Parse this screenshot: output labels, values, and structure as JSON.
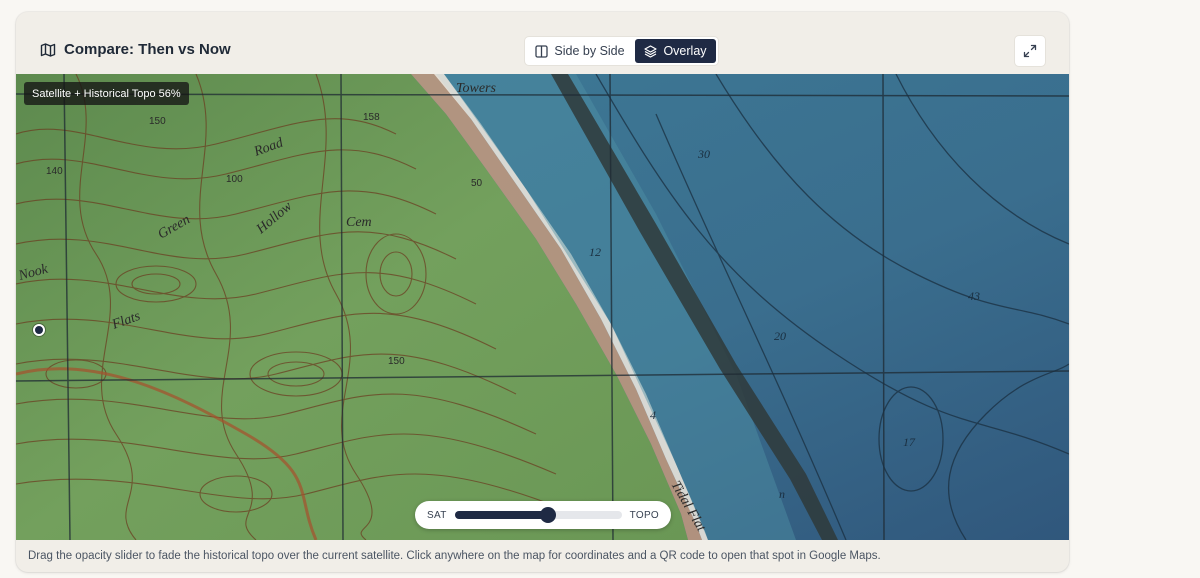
{
  "header": {
    "title": "Compare: Then vs Now",
    "title_icon": "map-icon",
    "view_modes": [
      {
        "label": "Side by Side",
        "icon": "columns-icon",
        "active": false
      },
      {
        "label": "Overlay",
        "icon": "layers-icon",
        "active": true
      }
    ],
    "expand_icon": "expand-icon"
  },
  "map": {
    "layer_badge": "Satellite + Historical Topo 56%",
    "opacity_fraction": 0.56,
    "labels": [
      "Towers",
      "Road",
      "Green",
      "Hollow",
      "Cem",
      "Nook",
      "Flats",
      "Tidal Flat",
      "30",
      "12",
      "20",
      "43",
      "17",
      "150",
      "158",
      "100",
      "140",
      "50",
      "4",
      "n"
    ]
  },
  "slider": {
    "left_label": "SAT",
    "right_label": "TOPO",
    "value": 0.56
  },
  "footer": {
    "text": "Drag the opacity slider to fade the historical topo over the current satellite. Click anywhere on the map for coordinates and a QR code to open that spot in Google Maps."
  },
  "colors": {
    "accent": "#1f2a44",
    "land": "#6f9a5c",
    "water": "#3f7a95",
    "contour": "#6b3a1f"
  }
}
